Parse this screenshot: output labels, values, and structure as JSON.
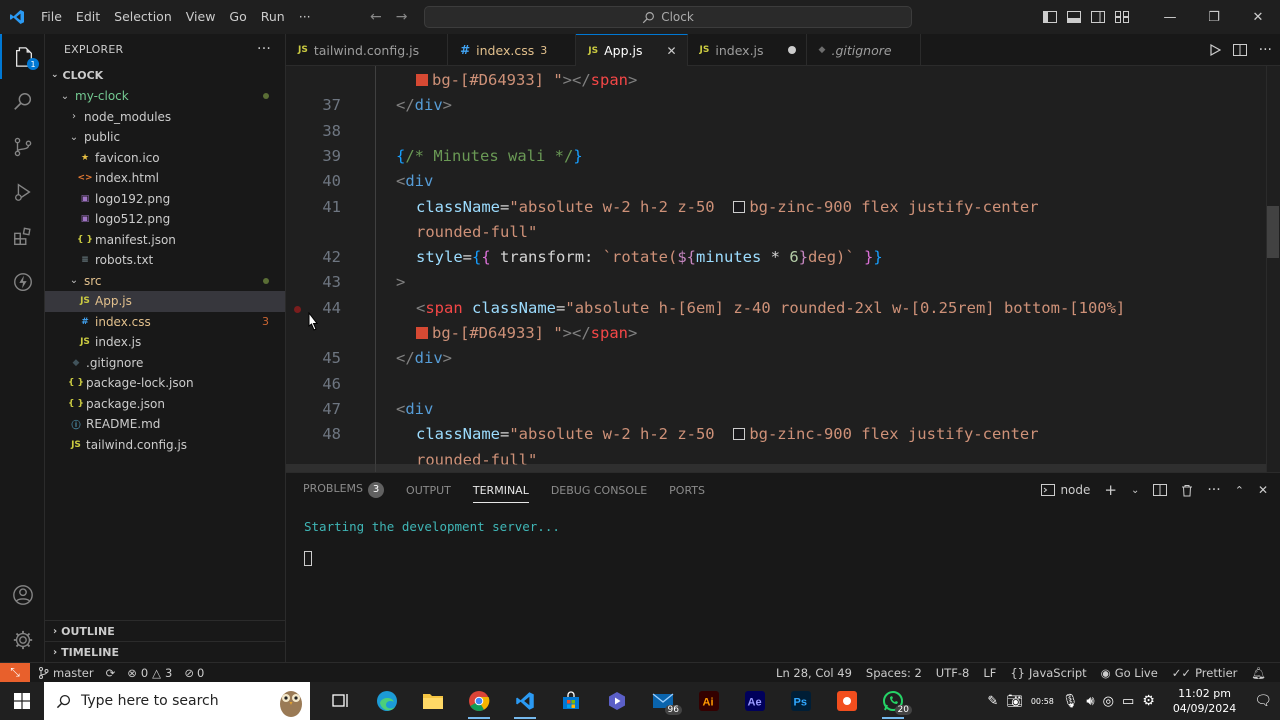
{
  "titlebar": {
    "menus": [
      "File",
      "Edit",
      "Selection",
      "View",
      "Go",
      "Run",
      "···"
    ],
    "search_text": "Clock"
  },
  "activity": {
    "explorer_badge": "1"
  },
  "sidebar": {
    "header": "EXPLORER",
    "section": "CLOCK",
    "tree": [
      {
        "label": "my-clock",
        "depth": 1,
        "kind": "folder-open",
        "color": "#73c991",
        "mod": true
      },
      {
        "label": "node_modules",
        "depth": 2,
        "kind": "folder-closed",
        "color": "#cccccc"
      },
      {
        "label": "public",
        "depth": 2,
        "kind": "folder-open",
        "color": "#cccccc"
      },
      {
        "label": "favicon.ico",
        "depth": 3,
        "kind": "star",
        "color": "#cccccc"
      },
      {
        "label": "index.html",
        "depth": 3,
        "kind": "html",
        "color": "#cccccc"
      },
      {
        "label": "logo192.png",
        "depth": 3,
        "kind": "img",
        "color": "#cccccc"
      },
      {
        "label": "logo512.png",
        "depth": 3,
        "kind": "img",
        "color": "#cccccc"
      },
      {
        "label": "manifest.json",
        "depth": 3,
        "kind": "json",
        "color": "#cccccc"
      },
      {
        "label": "robots.txt",
        "depth": 3,
        "kind": "txt",
        "color": "#cccccc"
      },
      {
        "label": "src",
        "depth": 2,
        "kind": "folder-open",
        "color": "#e2c08d",
        "mod": true
      },
      {
        "label": "App.js",
        "depth": 3,
        "kind": "js",
        "color": "#e2c08d",
        "selected": true
      },
      {
        "label": "index.css",
        "depth": 3,
        "kind": "css",
        "color": "#e2c08d",
        "count": "3"
      },
      {
        "label": "index.js",
        "depth": 3,
        "kind": "js",
        "color": "#cccccc"
      },
      {
        "label": ".gitignore",
        "depth": 2,
        "kind": "git",
        "color": "#cccccc"
      },
      {
        "label": "package-lock.json",
        "depth": 2,
        "kind": "json",
        "color": "#cccccc"
      },
      {
        "label": "package.json",
        "depth": 2,
        "kind": "json",
        "color": "#cccccc"
      },
      {
        "label": "README.md",
        "depth": 2,
        "kind": "info",
        "color": "#cccccc"
      },
      {
        "label": "tailwind.config.js",
        "depth": 2,
        "kind": "js",
        "color": "#cccccc"
      }
    ],
    "outline": "OUTLINE",
    "timeline": "TIMELINE"
  },
  "tabs": [
    {
      "label": "tailwind.config.js",
      "kind": "js"
    },
    {
      "label": "index.css",
      "kind": "css",
      "count": "3"
    },
    {
      "label": "App.js",
      "kind": "js",
      "active": true
    },
    {
      "label": "index.js",
      "kind": "js",
      "dirty": true
    },
    {
      "label": ".gitignore",
      "kind": "git"
    }
  ],
  "editor": {
    "lines": [
      {
        "n": "",
        "html": "<span class=\"sw\" style=\"background:#D64933\"></span><span class=\"str\">bg-[#D64933] \"</span><span class=\"ang\">&gt;&lt;/</span><span class=\"strr\">span</span><span class=\"ang\">&gt;</span>",
        "indent": 1
      },
      {
        "n": "37",
        "html": "<span class=\"ang\">&lt;/</span><span class=\"tag\">div</span><span class=\"ang\">&gt;</span>",
        "indent": 0
      },
      {
        "n": "38",
        "html": "",
        "indent": 0
      },
      {
        "n": "39",
        "html": "<span class=\"brk\">{</span><span class=\"com\">/* Minutes wali */</span><span class=\"brk\">}</span>",
        "indent": 0
      },
      {
        "n": "40",
        "html": "<span class=\"ang\">&lt;</span><span class=\"tag\">div</span>",
        "indent": 0
      },
      {
        "n": "41",
        "html": "<span class=\"attr\">className</span><span class=\"pun\">=</span><span class=\"str\">\"absolute w-2 h-2 z-50  </span><span class=\"sw\" style=\"border:1px solid #ccc;background:#18181b\"></span><span class=\"str\">bg-zinc-900 flex justify-center</span>",
        "indent": 1
      },
      {
        "n": "",
        "html": "<span class=\"str\">rounded-full\"</span>",
        "indent": 1
      },
      {
        "n": "42",
        "html": "<span class=\"attr\">style</span><span class=\"pun\">=</span><span class=\"brk\">{</span><span class=\"brk2\">{</span><span class=\"pun\"> transform: </span><span class=\"str\">`rotate(</span><span class=\"kw\">${</span><span class=\"var\">minutes</span><span class=\"pun\"> * </span><span class=\"num\">6</span><span class=\"kw\">}</span><span class=\"str\">deg)`</span><span class=\"pun\"> </span><span class=\"brk2\">}</span><span class=\"brk\">}</span>",
        "indent": 1
      },
      {
        "n": "43",
        "html": "<span class=\"ang\">&gt;</span>",
        "indent": 0
      },
      {
        "n": "44",
        "html": "<span class=\"ang\">&lt;</span><span class=\"strr\">span</span><span class=\"pun\"> </span><span class=\"attr\">className</span><span class=\"pun\">=</span><span class=\"str\">\"absolute h-[6em] z-40 rounded-2xl w-[0.25rem] bottom-[100%]</span>",
        "indent": 1
      },
      {
        "n": "",
        "html": "<span class=\"sw\" style=\"background:#D64933\"></span><span class=\"str\">bg-[#D64933] \"</span><span class=\"ang\">&gt;&lt;/</span><span class=\"strr\">span</span><span class=\"ang\">&gt;</span>",
        "indent": 1
      },
      {
        "n": "45",
        "html": "<span class=\"ang\">&lt;/</span><span class=\"tag\">div</span><span class=\"ang\">&gt;</span>",
        "indent": 0
      },
      {
        "n": "46",
        "html": "",
        "indent": 0
      },
      {
        "n": "47",
        "html": "<span class=\"ang\">&lt;</span><span class=\"tag\">div</span>",
        "indent": 0
      },
      {
        "n": "48",
        "html": "<span class=\"attr\">className</span><span class=\"pun\">=</span><span class=\"str\">\"absolute w-2 h-2 z-50  </span><span class=\"sw\" style=\"border:1px solid #ccc;background:#18181b\"></span><span class=\"str\">bg-zinc-900 flex justify-center</span>",
        "indent": 1
      },
      {
        "n": "",
        "html": "<span class=\"str\">rounded-full\"</span>",
        "indent": 1
      }
    ]
  },
  "panel": {
    "tabs": [
      "PROBLEMS",
      "OUTPUT",
      "TERMINAL",
      "DEBUG CONSOLE",
      "PORTS"
    ],
    "problems_count": "3",
    "active_tab": "TERMINAL",
    "terminal_name": "node",
    "terminal_output": "Starting the development server..."
  },
  "status": {
    "branch": "master",
    "errors": "0",
    "warnings": "3",
    "ports": "0",
    "position": "Ln 28, Col 49",
    "spaces": "Spaces: 2",
    "encoding": "UTF-8",
    "eol": "LF",
    "language": "JavaScript",
    "golive": "Go Live",
    "prettier": "Prettier"
  },
  "taskbar": {
    "search_placeholder": "Type here to search",
    "mail_badge": "96",
    "whatsapp_badge": "20",
    "tray_text": "00:58",
    "time": "11:02 pm",
    "date": "04/09/2024"
  },
  "colors": {
    "accent": "#0078d4",
    "remote": "#e8602c",
    "swatch": "#D64933"
  }
}
